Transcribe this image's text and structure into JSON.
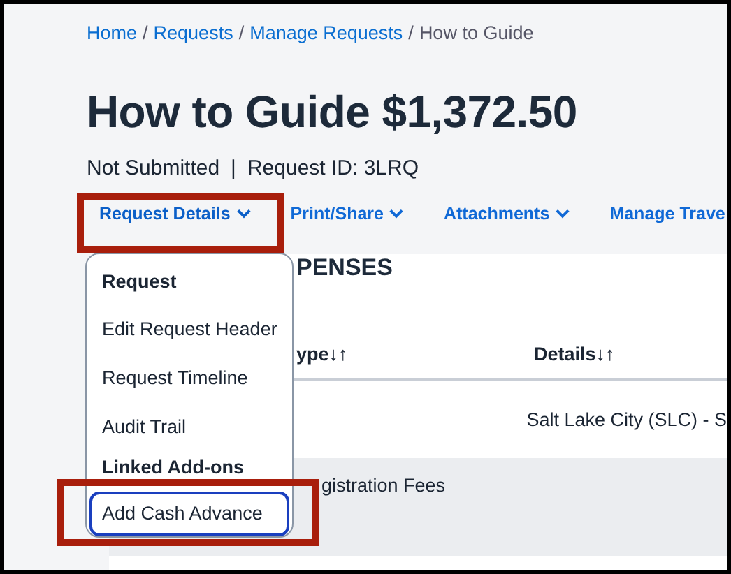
{
  "breadcrumb": [
    {
      "label": "Home",
      "current": false
    },
    {
      "label": "Requests",
      "current": false,
      "separator": "/"
    },
    {
      "label": "Manage Requests",
      "current": false,
      "separator": "/"
    },
    {
      "label": "How to Guide",
      "current": true,
      "separator": "/"
    }
  ],
  "status_separator": "|",
  "title": "How to Guide $1,372.50",
  "status": "Not Submitted",
  "request_id": "Request ID: 3LRQ",
  "nav": [
    {
      "label": "Request Details",
      "selected": true
    },
    {
      "label": "Print/Share",
      "selected": false
    },
    {
      "label": "Attachments",
      "selected": false
    },
    {
      "label": "Manage Trave",
      "selected": false
    }
  ],
  "section_title": "PENSES",
  "table": {
    "columns": [
      "ype↓↑",
      "Details↓↑"
    ],
    "rows": [
      {
        "shaded": false,
        "cells": [
          "",
          "Salt Lake City (SLC) - S"
        ]
      },
      {
        "shaded": true,
        "cells": [
          "gistration Fees",
          ""
        ]
      }
    ]
  },
  "menu": [
    {
      "kind": "heading",
      "label": "Request"
    },
    {
      "kind": "item",
      "label": "Edit Request Header",
      "focused": false
    },
    {
      "kind": "item",
      "label": "Request Timeline",
      "focused": false
    },
    {
      "kind": "item",
      "label": "Audit Trail",
      "focused": false
    },
    {
      "kind": "heading",
      "label": "Linked Add-ons"
    },
    {
      "kind": "item",
      "label": "Add Cash Advance",
      "focused": true
    }
  ]
}
